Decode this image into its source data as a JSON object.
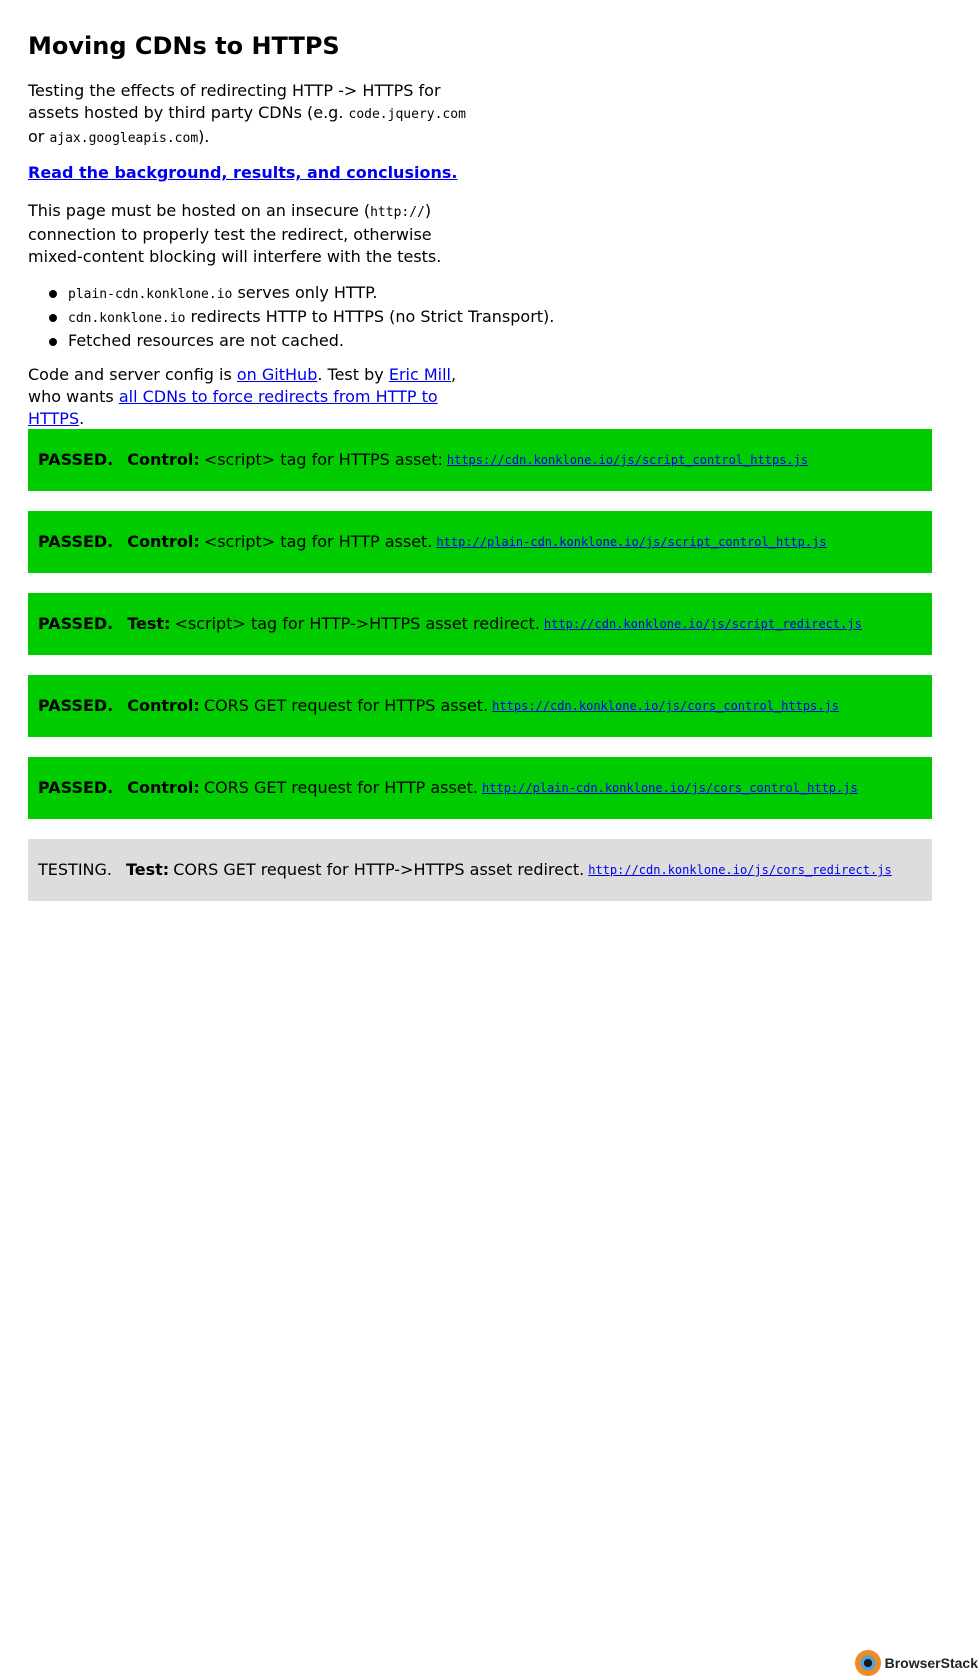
{
  "title": "Moving CDNs to HTTPS",
  "intro": {
    "p1_text1": "Testing the effects of redirecting HTTP -> HTTPS for assets hosted by third party CDNs (e.g. ",
    "p1_code1": "code.jquery.com",
    "p1_text2": " or ",
    "p1_code2": "ajax.googleapis.com",
    "p1_text3": ").",
    "background_link": "Read the background, results, and conclusions.",
    "p2_text1": "This page must be hosted on an insecure (",
    "p2_code": "http://",
    "p2_text2": ") connection to properly test the redirect, otherwise mixed-content blocking will interfere with the tests.",
    "bullets": [
      {
        "code": "plain-cdn.konklone.io",
        "text": " serves only HTTP."
      },
      {
        "code": "cdn.konklone.io",
        "text": " redirects HTTP to HTTPS (no Strict Transport)."
      },
      {
        "code": "",
        "text": "Fetched resources are not cached."
      }
    ],
    "p3_text1": "Code and server config is ",
    "p3_link1": "on GitHub",
    "p3_text2": ". Test by ",
    "p3_link2": "Eric Mill",
    "p3_text3": ", who wants ",
    "p3_link3": "all CDNs to force redirects from HTTP to HTTPS",
    "p3_text4": "."
  },
  "tests": [
    {
      "status": "PASSED.",
      "kind": "Control:",
      "description": "<script> tag for HTTPS asset:",
      "url": "https://cdn.konklone.io/js/script_control_https.js"
    },
    {
      "status": "PASSED.",
      "kind": "Control:",
      "description": "<script> tag for HTTP asset.",
      "url": "http://plain-cdn.konklone.io/js/script_control_http.js"
    },
    {
      "status": "PASSED.",
      "kind": "Test:",
      "description": "<script> tag for HTTP->HTTPS asset redirect.",
      "url": "http://cdn.konklone.io/js/script_redirect.js"
    },
    {
      "status": "PASSED.",
      "kind": "Control:",
      "description": "CORS GET request for HTTPS asset.",
      "url": "https://cdn.konklone.io/js/cors_control_https.js"
    },
    {
      "status": "PASSED.",
      "kind": "Control:",
      "description": "CORS GET request for HTTP asset.",
      "url": "http://plain-cdn.konklone.io/js/cors_control_http.js"
    },
    {
      "status": "TESTING.",
      "kind": "Test:",
      "description": "CORS GET request for HTTP->HTTPS asset redirect.",
      "url": "http://cdn.konklone.io/js/cors_redirect.js"
    }
  ],
  "colors": {
    "passed": "#00cc00",
    "testing": "#dddddd",
    "link": "#0000ee"
  },
  "footer": {
    "brand": "BrowserStack",
    "logo_icon": "browserstack-logo-icon"
  }
}
